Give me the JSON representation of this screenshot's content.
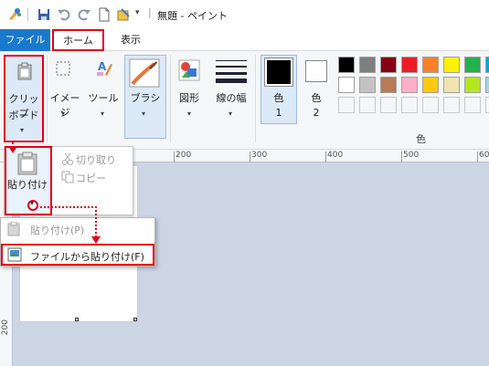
{
  "window": {
    "title": "無題 - ペイント",
    "title_separator": "|"
  },
  "quick_access": {
    "icons": [
      "paint-app-icon",
      "save-icon",
      "undo-icon",
      "redo-icon",
      "new-icon",
      "properties-icon",
      "customize-chevron-icon"
    ]
  },
  "tabs": {
    "file": "ファイル",
    "home": "ホーム",
    "view": "表示"
  },
  "ribbon": {
    "clipboard": {
      "label_line1": "クリップ",
      "label_line2": "ボード"
    },
    "image": {
      "label": "イメージ"
    },
    "tools": {
      "label": "ツール"
    },
    "brush": {
      "label": "ブラシ"
    },
    "shapes": {
      "label": "図形"
    },
    "line_width": {
      "label": "線の幅"
    },
    "color1": {
      "label_line1": "色",
      "label_line2": "1"
    },
    "color2": {
      "label_line1": "色",
      "label_line2": "2"
    },
    "colors_group_label": "色",
    "palette_row1": [
      "#000000",
      "#7f7f7f",
      "#880015",
      "#ed1c24",
      "#ff7f27",
      "#fff200",
      "#22b14c",
      "#00a2e8"
    ],
    "palette_row2": [
      "#ffffff",
      "#c3c3c3",
      "#b97a57",
      "#ffaec9",
      "#ffc90e",
      "#efe4b0",
      "#b5e61d",
      "#99d9ea"
    ]
  },
  "ruler": {
    "top": [
      "200",
      "300",
      "400",
      "500",
      "60"
    ],
    "left": [
      "200"
    ]
  },
  "clipboard_popup": {
    "paste_line1": "貼り付け",
    "cut": "切り取り",
    "copy": "コピー"
  },
  "paste_menu": {
    "item1": "貼り付け(P)",
    "item2": "ファイルから貼り付け(F)"
  },
  "colors": {
    "accent": "#1979ca",
    "highlight_red": "#e60012",
    "canvas_bg": "#cbd5e4"
  }
}
